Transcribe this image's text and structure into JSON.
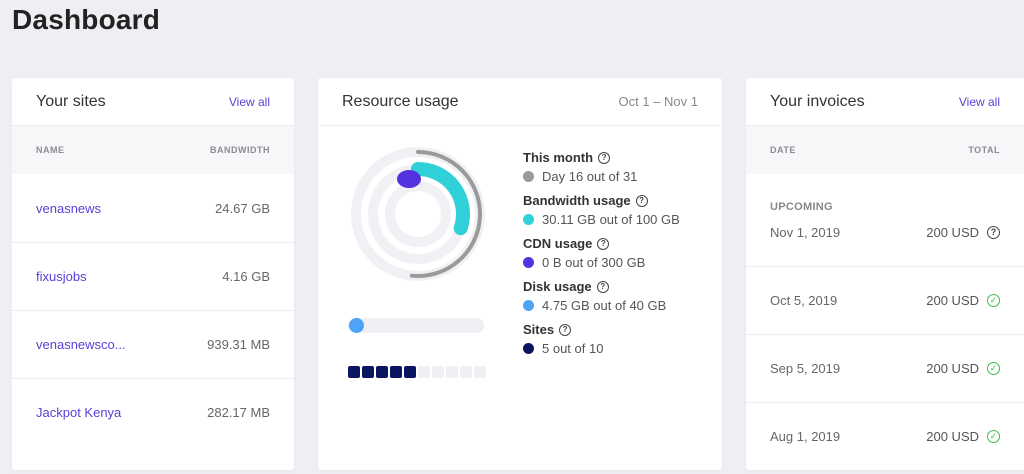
{
  "page": {
    "title": "Dashboard"
  },
  "sites": {
    "title": "Your sites",
    "view_all": "View all",
    "columns": [
      "NAME",
      "BANDWIDTH"
    ],
    "rows": [
      {
        "name": "venasnews",
        "bandwidth": "24.67 GB"
      },
      {
        "name": "fixusjobs",
        "bandwidth": "4.16 GB"
      },
      {
        "name": "venasnewsco...",
        "bandwidth": "939.31 MB"
      },
      {
        "name": "Jackpot Kenya",
        "bandwidth": "282.17 MB"
      }
    ]
  },
  "resources": {
    "title": "Resource usage",
    "range": "Oct 1 – Nov 1",
    "legend": {
      "this_month": {
        "title": "This month",
        "value": "Day 16 out of 31",
        "color": "#9a9a9a"
      },
      "bandwidth": {
        "title": "Bandwidth usage",
        "value": "30.11 GB out of 100 GB",
        "color": "#2fd0d8"
      },
      "cdn": {
        "title": "CDN usage",
        "value": "0 B out of 300 GB",
        "color": "#5432e0"
      },
      "disk": {
        "title": "Disk usage",
        "value": "4.75 GB out of 40 GB",
        "color": "#4da3f5"
      },
      "sites": {
        "title": "Sites",
        "value": "5 out of 10",
        "color": "#0b1560"
      }
    },
    "sites_used": 5,
    "sites_total": 10,
    "disk_fraction": 0.119,
    "month_fraction": 0.516,
    "bandwidth_fraction": 0.301,
    "help_glyph": "?"
  },
  "invoices": {
    "title": "Your invoices",
    "view_all": "View all",
    "columns": [
      "DATE",
      "TOTAL"
    ],
    "upcoming_label": "UPCOMING",
    "rows": [
      {
        "date": "Nov 1, 2019",
        "total": "200 USD",
        "status": "pending",
        "icon": "help-icon"
      },
      {
        "date": "Oct 5, 2019",
        "total": "200 USD",
        "status": "paid",
        "icon": "check-icon"
      },
      {
        "date": "Sep 5, 2019",
        "total": "200 USD",
        "status": "paid",
        "icon": "check-icon"
      },
      {
        "date": "Aug 1, 2019",
        "total": "200 USD",
        "status": "paid",
        "icon": "check-icon"
      }
    ],
    "colors": {
      "paid": "#3dbd4a",
      "pending": "#444444"
    }
  }
}
